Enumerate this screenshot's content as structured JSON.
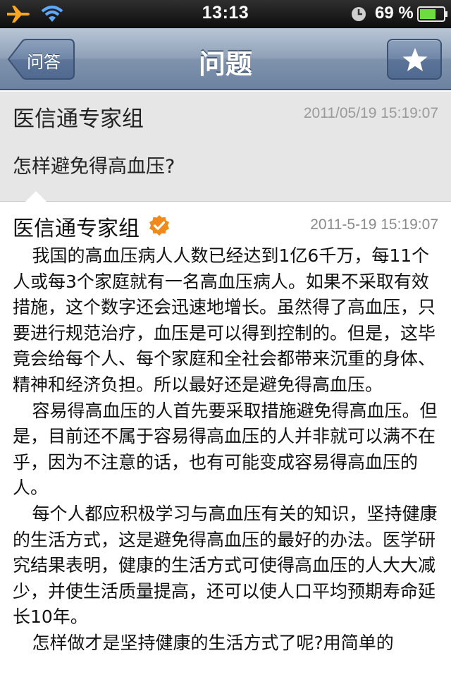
{
  "status_bar": {
    "time": "13:13",
    "battery_percent": "69 %",
    "icons": [
      "airplane-icon",
      "wifi-icon",
      "clock-icon",
      "battery-icon"
    ],
    "battery_level": 0.69
  },
  "nav": {
    "back_label": "问答",
    "title": "问题",
    "star_icon": "star-icon",
    "colors": {
      "bar": "#8fa1b8",
      "button": "#6f86a7"
    }
  },
  "question": {
    "author": "医信通专家组",
    "time": "2011/05/19 15:19:07",
    "text": "怎样避免得高血压?"
  },
  "answer": {
    "author": "医信通专家组",
    "verified_icon": "verified-badge-icon",
    "verified_color": "#f08a1c",
    "time": "2011-5-19 15:19:07",
    "paragraphs": [
      "我国的高血压病人人数已经达到1亿6千万，每11个人或每3个家庭就有一名高血压病人。如果不采取有效措施，这个数字还会迅速地增长。虽然得了高血压，只要进行规范治疗，血压是可以得到控制的。但是，这毕竟会给每个人、每个家庭和全社会都带来沉重的身体、精神和经济负担。所以最好还是避免得高血压。",
      "容易得高血压的人首先要采取措施避免得高血压。但是，目前还不属于容易得高血压的人并非就可以满不在乎，因为不注意的话，也有可能变成容易得高血压的人。",
      "每个人都应积极学习与高血压有关的知识，坚持健康的生活方式，这是避免得高血压的最好的办法。医学研究结果表明，健康的生活方式可使得高血压的人大大减少，并使生活质量提高，还可以使人口平均预期寿命延长10年。",
      "怎样做才是坚持健康的生活方式了呢?用简单的"
    ]
  }
}
